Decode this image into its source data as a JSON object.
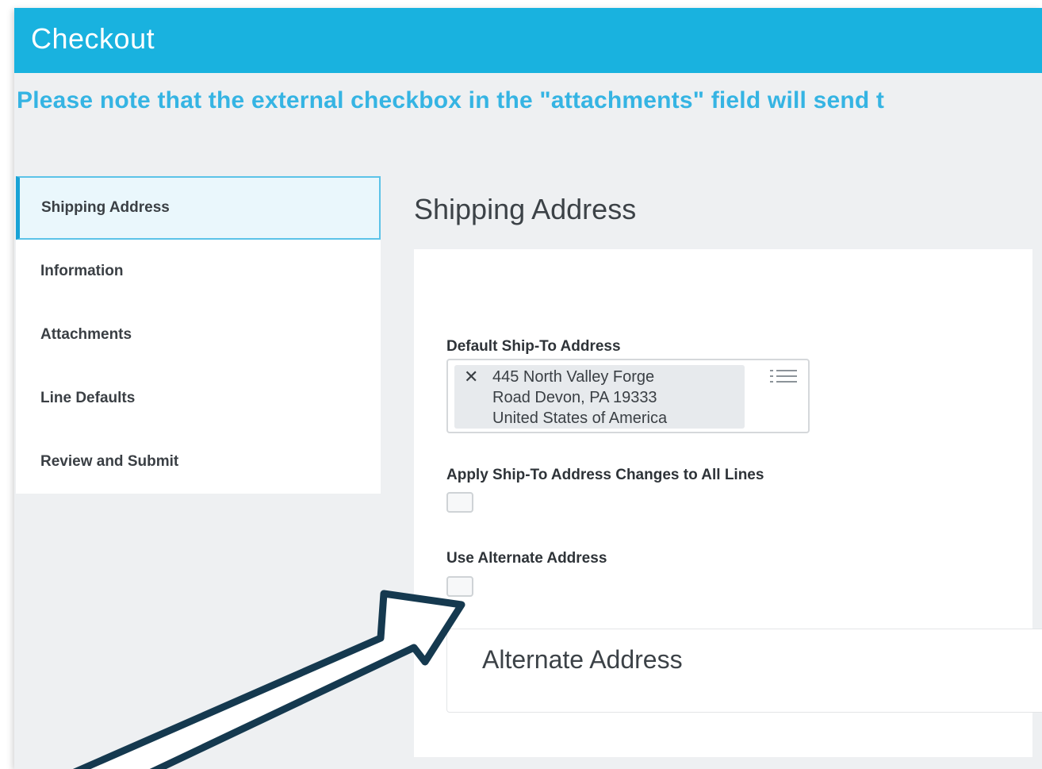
{
  "header": {
    "title": "Checkout"
  },
  "notice": "Please note that the external checkbox in the \"attachments\" field will send t",
  "sidebar": {
    "items": [
      {
        "label": "Shipping Address",
        "active": true
      },
      {
        "label": "Information",
        "active": false
      },
      {
        "label": "Attachments",
        "active": false
      },
      {
        "label": "Line Defaults",
        "active": false
      },
      {
        "label": "Review and Submit",
        "active": false
      }
    ]
  },
  "main": {
    "section_title": "Shipping Address",
    "default_ship_to": {
      "label": "Default Ship-To Address",
      "address_lines": [
        "445 North Valley Forge",
        "Road Devon, PA 19333",
        "United States of America"
      ]
    },
    "apply_changes": {
      "label": "Apply Ship-To Address Changes to All Lines",
      "checked": false
    },
    "use_alternate": {
      "label": "Use Alternate Address",
      "checked": false
    },
    "alternate_section": {
      "title": "Alternate Address"
    }
  },
  "colors": {
    "header_bg": "#19b2df",
    "notice_text": "#35b4e3",
    "arrow_stroke": "#15394f"
  },
  "icons": [
    "remove-x-icon",
    "list-icon",
    "annotation-arrow"
  ]
}
